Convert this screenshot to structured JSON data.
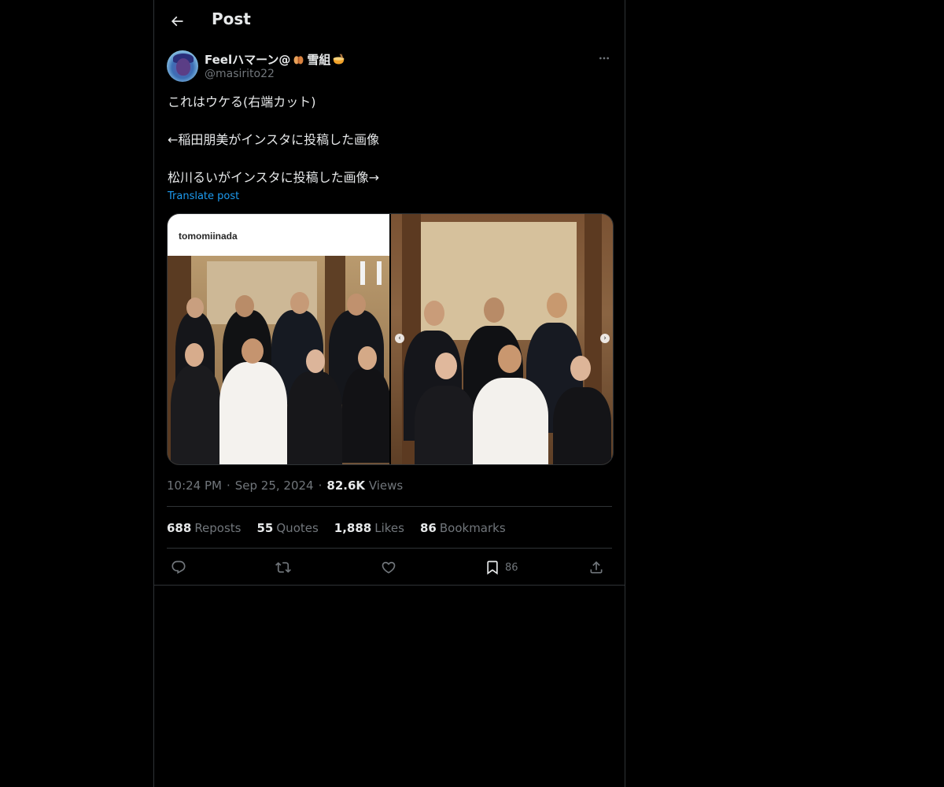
{
  "header": {
    "title": "Post",
    "back_icon": "arrow-left-icon"
  },
  "author": {
    "display_name": "Feelハマーン@",
    "name_suffix": "雪組",
    "handle": "@masirito22",
    "emojis": [
      "clapping-hands-emoji",
      "ramen-bowl-emoji"
    ]
  },
  "post": {
    "text": "これはウケる(右端カット)\n\n←稲田朋美がインスタに投稿した画像\n\n松川るいがインスタに投稿した画像→",
    "translate_label": "Translate post",
    "media": {
      "left_overlay_username": "tomomiinada"
    }
  },
  "meta": {
    "time": "10:24 PM",
    "separator": "·",
    "date": "Sep 25, 2024",
    "views_count": "82.6K",
    "views_label": "Views"
  },
  "stats": [
    {
      "count": "688",
      "label": "Reposts"
    },
    {
      "count": "55",
      "label": "Quotes"
    },
    {
      "count": "1,888",
      "label": "Likes"
    },
    {
      "count": "86",
      "label": "Bookmarks"
    }
  ],
  "actions": {
    "reply_icon": "reply-icon",
    "repost_icon": "repost-icon",
    "like_icon": "heart-icon",
    "bookmark_icon": "bookmark-icon",
    "bookmark_count": "86",
    "share_icon": "share-icon"
  },
  "colors": {
    "background": "#000000",
    "text_primary": "#e7e9ea",
    "text_secondary": "#71767b",
    "link": "#1d9bf0",
    "border": "#2f3336"
  }
}
